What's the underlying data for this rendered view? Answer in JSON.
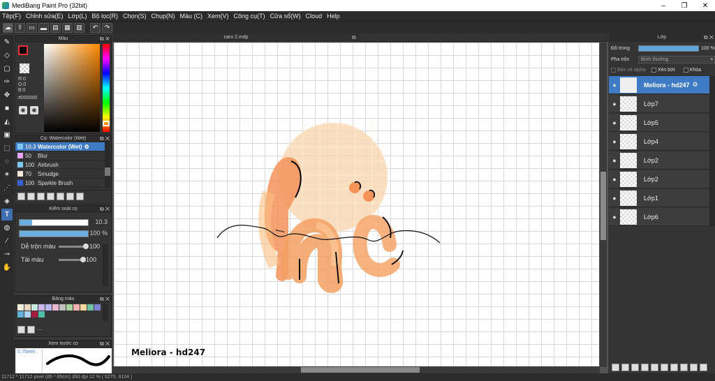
{
  "window": {
    "title": "MediBang Paint Pro (32bit)",
    "minimize": "–",
    "maximize": "❐",
    "close": "✕"
  },
  "menu": [
    "Tệp(F)",
    "Chỉnh sửa(E)",
    "Lớp(L)",
    "Bộ lọc(R)",
    "Chọn(S)",
    "Chụp(N)",
    "Màu (C)",
    "Xem(V)",
    "Công cụ(T)",
    "Cửa sổ(W)",
    "Cloud",
    "Help"
  ],
  "color_panel": {
    "title": "Màu",
    "r": "R:0",
    "g": "G:0",
    "b": "B:0",
    "hex": "#000000",
    "foreground": "#000000",
    "background": "#ffffff"
  },
  "brush_panel": {
    "title": "Cọ: Watercolor (Wet)",
    "items": [
      {
        "size": "10.3",
        "name": "Watercolor (Wet)",
        "color": "#7ec8f0"
      },
      {
        "size": "50",
        "name": "Blur",
        "color": "#e6a6f5"
      },
      {
        "size": "100",
        "name": "Airbrush",
        "color": "#7ec8f0"
      },
      {
        "size": "70",
        "name": "Smudge",
        "color": "#f5e9d9"
      },
      {
        "size": "100",
        "name": "Sparkle Brush",
        "color": "#3a5fd9"
      }
    ]
  },
  "brush_control": {
    "title": "Kiểm soát cọ",
    "size_value": "10.3",
    "opacity_value": "100 %",
    "blend_label": "Dễ trộn màu",
    "blend_value": "100",
    "reload_label": "Tải màu",
    "reload_value": "100"
  },
  "swatch_panel": {
    "title": "Bảng màu",
    "more": "···",
    "colors": [
      "#f3f1dc",
      "#e8d8c0",
      "#c8e8e0",
      "#c8b8e8",
      "#b8b8f0",
      "#e8b8d0",
      "#c0c0c0",
      "#a8d0a0",
      "#f0b0b0",
      "#f8d8a0",
      "#70c0a0",
      "#8080d0",
      "#60b0d8",
      "#b0d0f0",
      "#a02040",
      "#50c0a8"
    ]
  },
  "preview_panel": {
    "title": "Xem trước cọ",
    "size_label": "0.75mm"
  },
  "canvas": {
    "tab_title": "caro 2.mdp",
    "watermark": "Meliora - hd247"
  },
  "layer_panel": {
    "title": "Lớp",
    "opacity_label": "Độ trong",
    "opacity_value": "100 %",
    "blend_label": "Pha trộn",
    "blend_value": "Bình thường",
    "protect_alpha": "Bảo vệ alpha",
    "clipping": "Xén bớt",
    "lock": "Khóa",
    "layers": [
      "Meliora - hd247",
      "Lớp7",
      "Lớp5",
      "Lớp4",
      "Lớp2",
      "Lớp2",
      "Lớp1",
      "Lớp6"
    ]
  },
  "status": "11712 * 11712 pixel  (85 * 85cm)  350 dpi  12 %  ( 5270, 9104 )"
}
